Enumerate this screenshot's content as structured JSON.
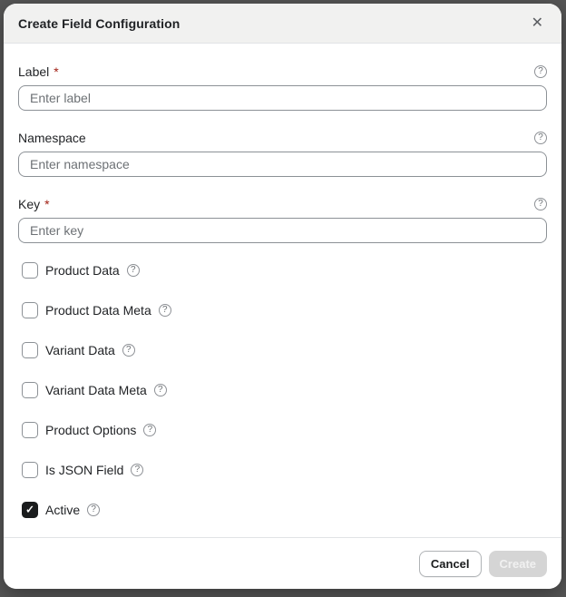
{
  "modal": {
    "title": "Create Field Configuration"
  },
  "icons": {
    "close": "✕",
    "help": "?",
    "check": "✓"
  },
  "required_marker": "*",
  "fields": [
    {
      "label": "Label",
      "required": true,
      "placeholder": "Enter label",
      "value": ""
    },
    {
      "label": "Namespace",
      "required": false,
      "placeholder": "Enter namespace",
      "value": ""
    },
    {
      "label": "Key",
      "required": true,
      "placeholder": "Enter key",
      "value": ""
    }
  ],
  "checkboxes": [
    {
      "label": "Product Data",
      "checked": false
    },
    {
      "label": "Product Data Meta",
      "checked": false
    },
    {
      "label": "Variant Data",
      "checked": false
    },
    {
      "label": "Variant Data Meta",
      "checked": false
    },
    {
      "label": "Product Options",
      "checked": false
    },
    {
      "label": "Is JSON Field",
      "checked": false
    },
    {
      "label": "Active",
      "checked": true
    }
  ],
  "footer": {
    "cancel_label": "Cancel",
    "create_label": "Create",
    "create_disabled": true
  },
  "colors": {
    "overlay": "#565656",
    "header_bg": "#f1f1f0",
    "required": "#9f1b0f",
    "checkbox_checked": "#1a1c1d",
    "input_border": "#8c9196",
    "disabled_button_bg": "#d5d5d5"
  }
}
